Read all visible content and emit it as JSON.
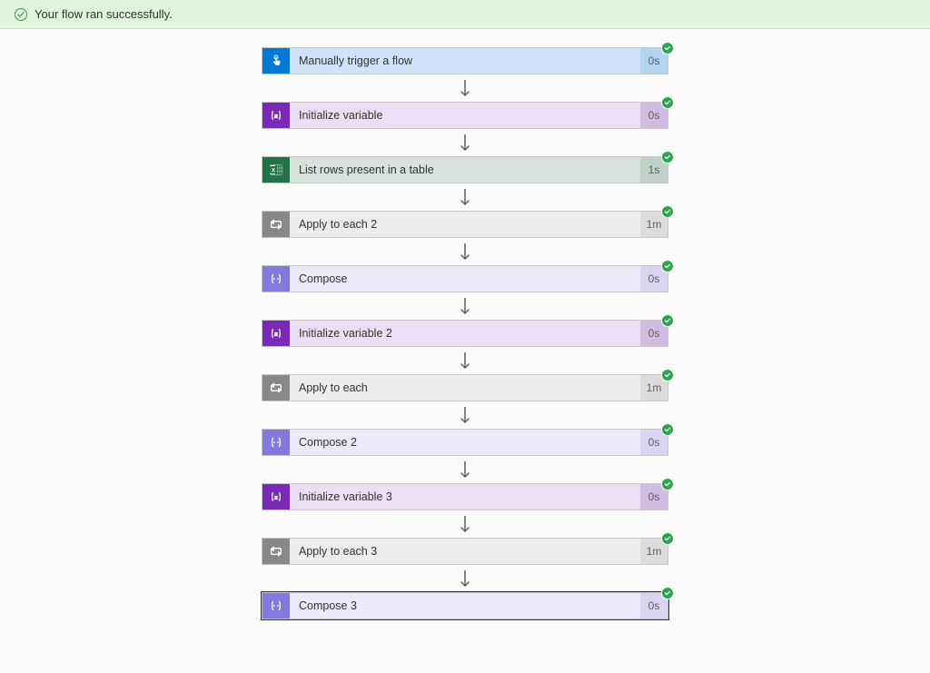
{
  "banner": {
    "message": "Your flow ran successfully."
  },
  "steps": [
    {
      "label": "Manually trigger a flow",
      "duration": "0s",
      "theme": "blue",
      "icon": "touch",
      "selected": false
    },
    {
      "label": "Initialize variable",
      "duration": "0s",
      "theme": "purple",
      "icon": "variable",
      "selected": false
    },
    {
      "label": "List rows present in a table",
      "duration": "1s",
      "theme": "green",
      "icon": "excel",
      "selected": false
    },
    {
      "label": "Apply to each 2",
      "duration": "1m",
      "theme": "gray",
      "icon": "loop",
      "selected": false
    },
    {
      "label": "Compose",
      "duration": "0s",
      "theme": "lightpurple",
      "icon": "compose",
      "selected": false
    },
    {
      "label": "Initialize variable 2",
      "duration": "0s",
      "theme": "purple",
      "icon": "variable",
      "selected": false
    },
    {
      "label": "Apply to each",
      "duration": "1m",
      "theme": "gray",
      "icon": "loop",
      "selected": false
    },
    {
      "label": "Compose 2",
      "duration": "0s",
      "theme": "lightpurple",
      "icon": "compose",
      "selected": false
    },
    {
      "label": "Initialize variable 3",
      "duration": "0s",
      "theme": "purple",
      "icon": "variable",
      "selected": false
    },
    {
      "label": "Apply to each 3",
      "duration": "1m",
      "theme": "gray",
      "icon": "loop",
      "selected": false
    },
    {
      "label": "Compose 3",
      "duration": "0s",
      "theme": "lightpurple",
      "icon": "compose",
      "selected": true
    }
  ]
}
